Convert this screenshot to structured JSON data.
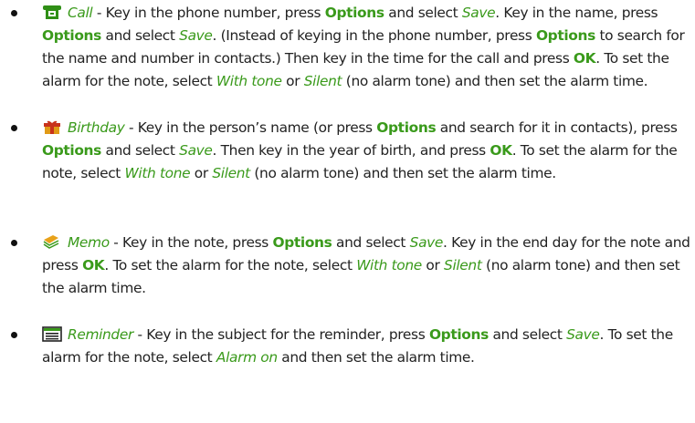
{
  "colors": {
    "accent_green": "#3a9a1b",
    "text": "#222222"
  },
  "items": [
    {
      "icon": "phone-icon",
      "title": "Call",
      "segments": [
        {
          "t": " - Key in the phone number, press ",
          "s": ""
        },
        {
          "t": "Options",
          "s": "g b"
        },
        {
          "t": " and select ",
          "s": ""
        },
        {
          "t": "Save",
          "s": "g i"
        },
        {
          "t": ". Key in the name, press ",
          "s": ""
        },
        {
          "t": "Options",
          "s": "g b"
        },
        {
          "t": " and select ",
          "s": ""
        },
        {
          "t": "Save",
          "s": "g i"
        },
        {
          "t": ". (Instead of keying in the phone number, press ",
          "s": ""
        },
        {
          "t": "Options",
          "s": "g b"
        },
        {
          "t": " to search for the name and number in contacts.) Then key in the time for the call and press ",
          "s": ""
        },
        {
          "t": "OK",
          "s": "g b"
        },
        {
          "t": ". To set the alarm for the note, select ",
          "s": ""
        },
        {
          "t": "With tone",
          "s": "g i"
        },
        {
          "t": " or ",
          "s": ""
        },
        {
          "t": "Silent",
          "s": "g i"
        },
        {
          "t": " (no alarm tone) and then set the alarm time.",
          "s": ""
        }
      ]
    },
    {
      "icon": "gift-icon",
      "title": "Birthday",
      "segments": [
        {
          "t": " - Key in the person’s name (or press ",
          "s": ""
        },
        {
          "t": "Options",
          "s": "g b"
        },
        {
          "t": " and search for it in contacts), press ",
          "s": ""
        },
        {
          "t": "Options",
          "s": "g b"
        },
        {
          "t": " and select ",
          "s": ""
        },
        {
          "t": "Save",
          "s": "g i"
        },
        {
          "t": ". Then key in the year of birth, and press ",
          "s": ""
        },
        {
          "t": "OK",
          "s": "g b"
        },
        {
          "t": ". To set the alarm for the note, select ",
          "s": ""
        },
        {
          "t": "With tone",
          "s": "g i"
        },
        {
          "t": " or ",
          "s": ""
        },
        {
          "t": "Silent",
          "s": "g i"
        },
        {
          "t": " (no alarm tone) and then set the alarm time.",
          "s": ""
        }
      ]
    },
    {
      "icon": "memo-icon",
      "title": "Memo",
      "segments": [
        {
          "t": " - Key in the note, press ",
          "s": ""
        },
        {
          "t": "Options",
          "s": "g b"
        },
        {
          "t": " and select ",
          "s": ""
        },
        {
          "t": "Save",
          "s": "g i"
        },
        {
          "t": ". Key in the end day for the note and press ",
          "s": ""
        },
        {
          "t": "OK",
          "s": "g b"
        },
        {
          "t": ". To set the alarm for the note, select ",
          "s": ""
        },
        {
          "t": "With tone",
          "s": "g i"
        },
        {
          "t": " or ",
          "s": ""
        },
        {
          "t": "Silent",
          "s": "g i"
        },
        {
          "t": " (no alarm tone) and then set the alarm time.",
          "s": ""
        }
      ]
    },
    {
      "icon": "reminder-icon",
      "title": "Reminder",
      "segments": [
        {
          "t": " - Key in the subject for the reminder, press ",
          "s": ""
        },
        {
          "t": "Options",
          "s": "g b"
        },
        {
          "t": " and select ",
          "s": ""
        },
        {
          "t": "Save",
          "s": "g i"
        },
        {
          "t": ". To set the alarm for the note, select ",
          "s": ""
        },
        {
          "t": "Alarm on",
          "s": "g i"
        },
        {
          "t": " and then set the alarm time.",
          "s": ""
        }
      ]
    }
  ]
}
